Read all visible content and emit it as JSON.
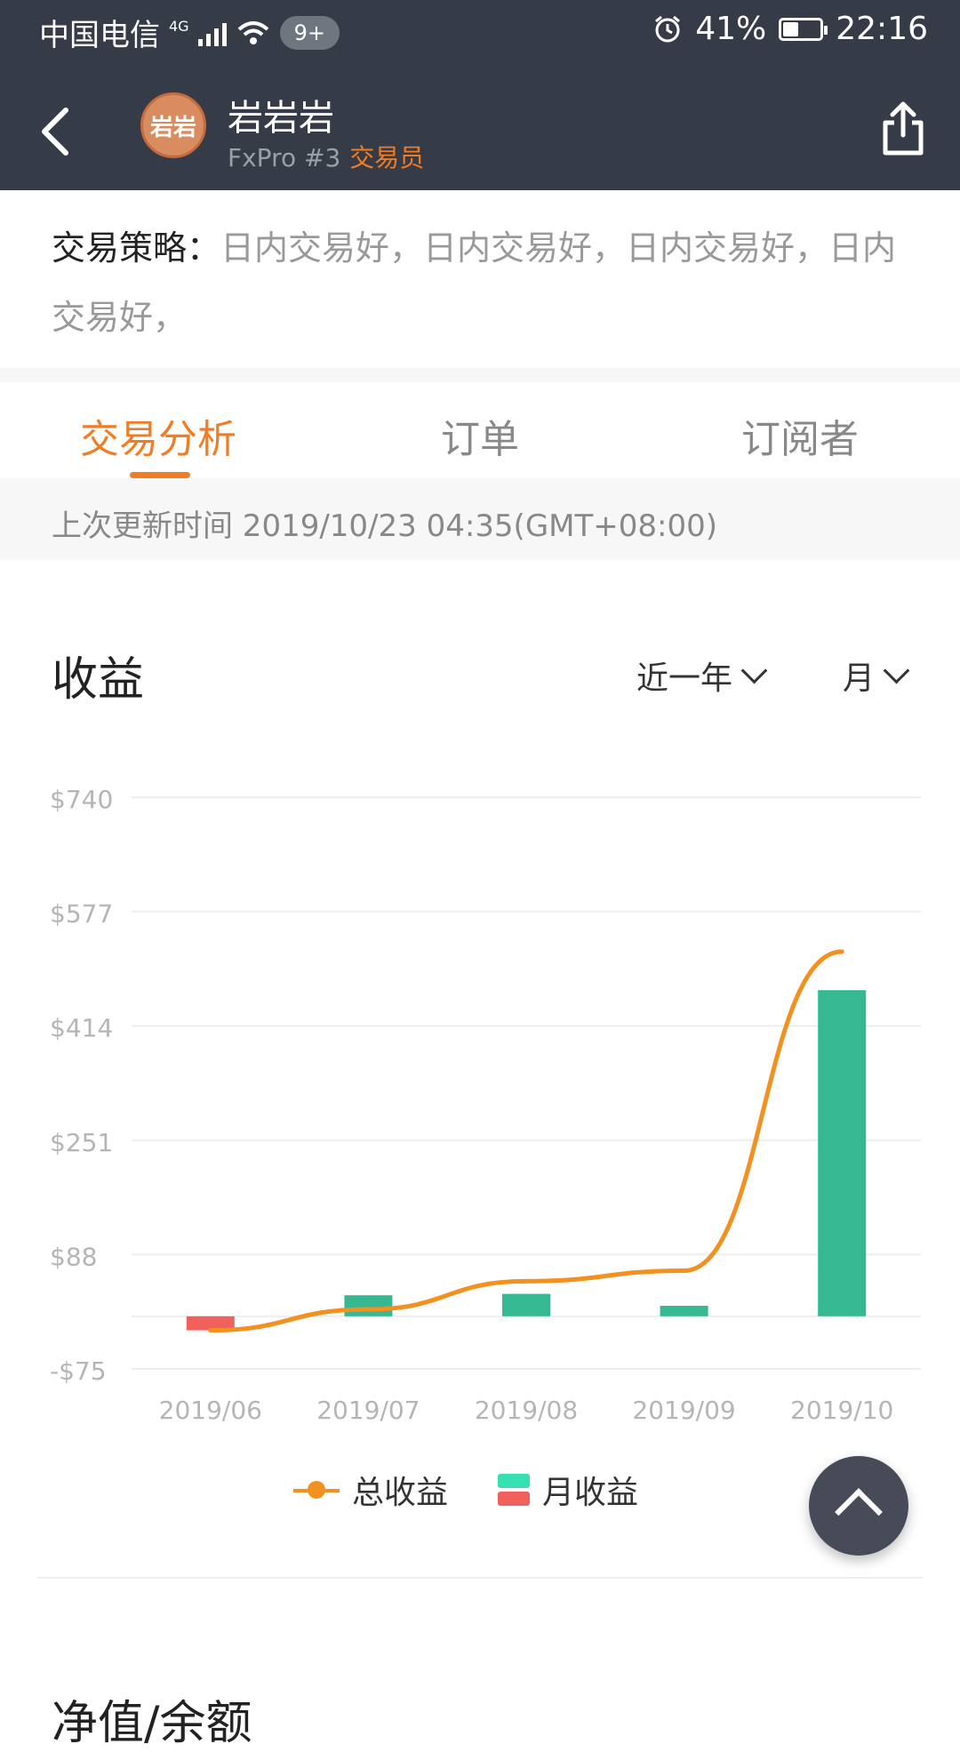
{
  "status_bar": {
    "carrier": "中国电信",
    "network": "4G",
    "notification_badge": "9+",
    "battery_percent": "41%",
    "battery_level": 0.41,
    "time": "22:16"
  },
  "header": {
    "avatar_text": "岩岩",
    "trader_name": "岩岩岩",
    "account": "FxPro #3",
    "role": "交易员"
  },
  "strategy": {
    "label": "交易策略：",
    "text": "日内交易好，日内交易好，日内交易好，日内交易好，"
  },
  "tabs": [
    {
      "label": "交易分析",
      "active": true
    },
    {
      "label": "订单",
      "active": false
    },
    {
      "label": "订阅者",
      "active": false
    }
  ],
  "update": {
    "text": "上次更新时间 2019/10/23 04:35(GMT+08:00)"
  },
  "earnings": {
    "title": "收益",
    "range_filter": "近一年",
    "period_filter": "月"
  },
  "chart_data": {
    "type": "bar",
    "categories": [
      "2019/06",
      "2019/07",
      "2019/08",
      "2019/09",
      "2019/10"
    ],
    "y_ticks": [
      "$740",
      "$577",
      "$414",
      "$251",
      "$88",
      "-$75"
    ],
    "ylim": [
      -75,
      740
    ],
    "grid": true,
    "legend_position": "bottom",
    "series": [
      {
        "name": "总收益",
        "kind": "line",
        "color": "#f29020",
        "values": [
          -20,
          10,
          50,
          65,
          520
        ]
      },
      {
        "name": "月收益",
        "kind": "bar",
        "color_positive": "#36b993",
        "color_negative": "#f0605d",
        "values": [
          -20,
          30,
          32,
          15,
          465
        ]
      }
    ]
  },
  "legend": {
    "total_label": "总收益",
    "monthly_label": "月收益",
    "monthly_colors": [
      "#36e0b0",
      "#f0605d"
    ]
  },
  "next_section": {
    "title": "净值/余额"
  }
}
